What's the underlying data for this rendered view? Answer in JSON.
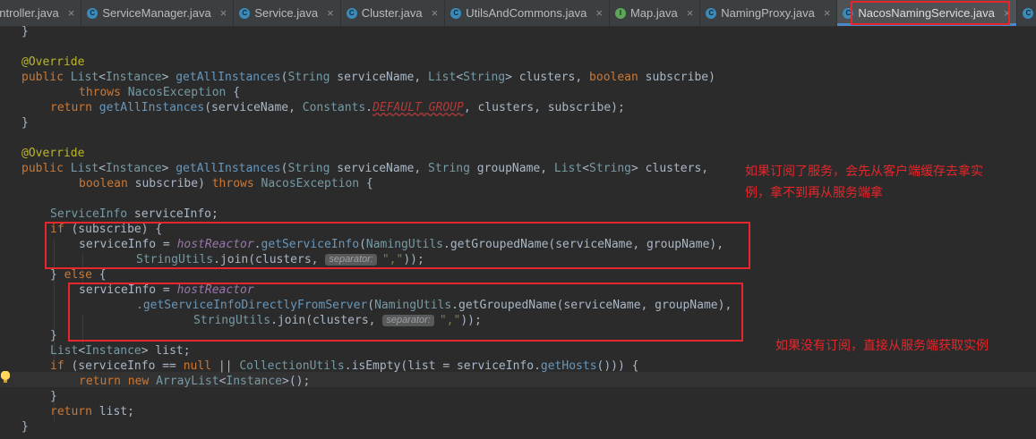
{
  "tabs": [
    {
      "label": "ontroller.java",
      "icon": "class-icon"
    },
    {
      "label": "ServiceManager.java",
      "icon": "class-icon"
    },
    {
      "label": "Service.java",
      "icon": "class-icon"
    },
    {
      "label": "Cluster.java",
      "icon": "class-icon"
    },
    {
      "label": "UtilsAndCommons.java",
      "icon": "class-icon"
    },
    {
      "label": "Map.java",
      "icon": "interface-icon"
    },
    {
      "label": "NamingProxy.java",
      "icon": "class-icon"
    },
    {
      "label": "NacosNamingService.java",
      "icon": "class-icon",
      "active": true
    }
  ],
  "tab_icon_letters": {
    "class": "C",
    "interface": "I"
  },
  "close_glyph": "×",
  "code": {
    "l01": "}",
    "l03_annotation": "@Override",
    "l04_public": "public",
    "l04_list": "List",
    "l04_instance": "Instance",
    "l04_method": "getAllInstances",
    "l04_string": "String",
    "l04_name1": "serviceName,",
    "l04_list2": "List",
    "l04_string2": "String",
    "l04_clusters": "clusters,",
    "l04_boolean": "boolean",
    "l04_subscribe": "subscribe)",
    "l05_throws": "throws",
    "l05_exc": "NacosException",
    "l05_brace": " {",
    "l06_return": "return",
    "l06_call": "getAllInstances",
    "l06_args1": "(serviceName, ",
    "l06_constants": "Constants",
    "l06_default_group": "DEFAULT_GROUP",
    "l06_args2": ", clusters, subscribe);",
    "l07": "}",
    "l09_annotation": "@Override",
    "l10_public": "public",
    "l10_list": "List",
    "l10_instance": "Instance",
    "l10_method": "getAllInstances",
    "l10_string": "String",
    "l10_name1": "serviceName,",
    "l10_string2": "String",
    "l10_group": "groupName,",
    "l10_list2": "List",
    "l10_string3": "String",
    "l10_clusters": "clusters,",
    "l11_boolean": "boolean",
    "l11_subscribe": "subscribe)",
    "l11_throws": "throws",
    "l11_exc": "NacosException",
    "l11_brace": " {",
    "l13_type": "ServiceInfo",
    "l13_var": " serviceInfo;",
    "l14_if": "if",
    "l14_cond": " (subscribe) {",
    "l15_lhs": "serviceInfo = ",
    "l15_hr": "hostReactor",
    "l15_call": "getServiceInfo",
    "l15_nu": "NamingUtils",
    "l15_args": ".getGroupedName(serviceName, groupName),",
    "l16_su": "StringUtils",
    "l16_join": ".join(clusters, ",
    "l16_hint": "separator:",
    "l16_sep": "\",\"",
    "l16_end": "));",
    "l17_close": "} ",
    "l17_else": "else",
    "l17_brace": " {",
    "l18_lhs": "serviceInfo = ",
    "l18_hr": "hostReactor",
    "l19_call": ".getServiceInfoDirectlyFromServer",
    "l19_nu": "NamingUtils",
    "l19_args": ".getGroupedName(serviceName, groupName),",
    "l20_su": "StringUtils",
    "l20_join": ".join(clusters, ",
    "l20_hint": "separator:",
    "l20_sep": "\",\"",
    "l20_end": "));",
    "l21": "}",
    "l22_list": "List",
    "l22_instance": "Instance",
    "l22_var": "> list;",
    "l23_if": "if",
    "l23_a": " (serviceInfo == ",
    "l23_null": "null",
    "l23_b": " || ",
    "l23_cu": "CollectionUtils",
    "l23_c": ".isEmpty(list = serviceInfo.",
    "l23_get": "getHosts",
    "l23_d": "())) {",
    "l24_return": "return",
    "l24_new": "new",
    "l24_al": "ArrayList",
    "l24_instance": "Instance",
    "l24_end": ">();",
    "l25": "}",
    "l26_return": "return",
    "l26_list": " list;",
    "l27": "}"
  },
  "annotations": {
    "subscribe_note_line1": "如果订阅了服务，会先从客户端缓存去拿实",
    "subscribe_note_line2": "例，拿不到再从服务端拿",
    "no_subscribe_note": "如果没有订阅，直接从服务端获取实例"
  },
  "colors": {
    "background": "#2b2b2b",
    "annotation_red": "#e5262b",
    "keyword": "#cc7832",
    "string": "#6a8759",
    "type": "#769aa5"
  }
}
